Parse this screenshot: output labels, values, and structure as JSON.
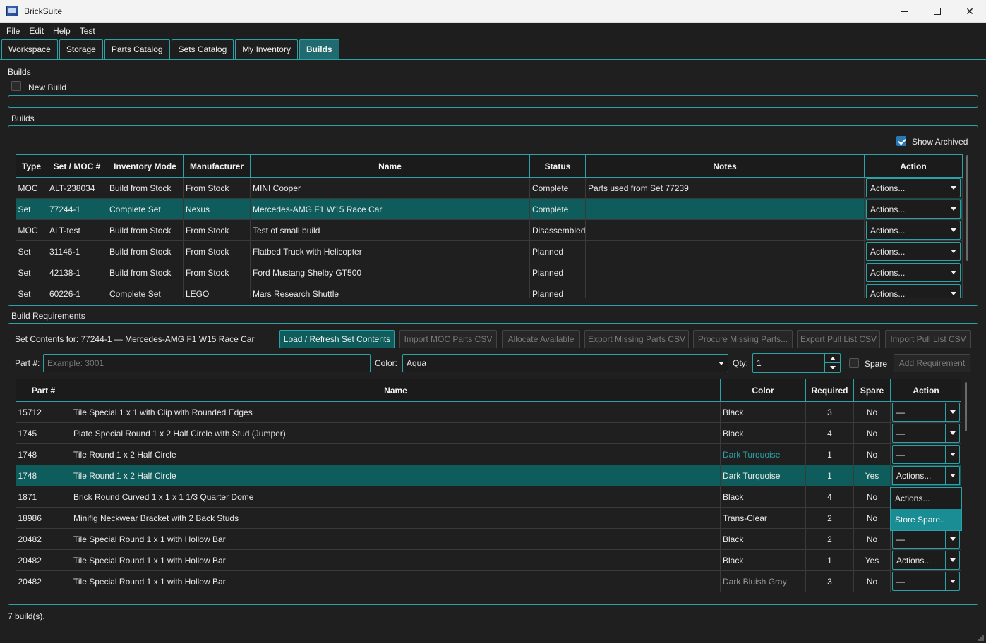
{
  "window": {
    "title": "BrickSuite",
    "min_icon": "minimize-icon",
    "max_icon": "maximize-icon",
    "close_icon": "close-icon",
    "close_glyph": "✕"
  },
  "menu": [
    "File",
    "Edit",
    "Help",
    "Test"
  ],
  "tabs": [
    {
      "label": "Workspace",
      "active": false
    },
    {
      "label": "Storage",
      "active": false
    },
    {
      "label": "Parts Catalog",
      "active": false
    },
    {
      "label": "Sets Catalog",
      "active": false
    },
    {
      "label": "My Inventory",
      "active": false
    },
    {
      "label": "Builds",
      "active": true
    }
  ],
  "builds_header": {
    "title": "Builds",
    "new_build_label": "New Build"
  },
  "builds_group": {
    "title": "Builds",
    "show_archived_label": "Show Archived",
    "show_archived": true,
    "columns": [
      "Type",
      "Set / MOC #",
      "Inventory Mode",
      "Manufacturer",
      "Name",
      "Status",
      "Notes",
      "Action"
    ],
    "rows": [
      {
        "type": "MOC",
        "number": "ALT-238034",
        "mode": "Build from Stock",
        "manufacturer": "From Stock",
        "name": "MINI Cooper",
        "status": "Complete",
        "notes": "Parts used from Set 77239",
        "action": "Actions..."
      },
      {
        "type": "Set",
        "number": "77244-1",
        "mode": "Complete Set",
        "manufacturer": "Nexus",
        "name": "Mercedes-AMG F1 W15 Race Car",
        "status": "Complete",
        "notes": "",
        "action": "Actions...",
        "selected": true
      },
      {
        "type": "MOC",
        "number": "ALT-test",
        "mode": "Build from Stock",
        "manufacturer": "From Stock",
        "name": "Test of small build",
        "status": "Disassembled",
        "notes": "",
        "action": "Actions..."
      },
      {
        "type": "Set",
        "number": "31146-1",
        "mode": "Build from Stock",
        "manufacturer": "From Stock",
        "name": "Flatbed Truck with Helicopter",
        "status": "Planned",
        "notes": "",
        "action": "Actions..."
      },
      {
        "type": "Set",
        "number": "42138-1",
        "mode": "Build from Stock",
        "manufacturer": "From Stock",
        "name": "Ford Mustang Shelby GT500",
        "status": "Planned",
        "notes": "",
        "action": "Actions..."
      },
      {
        "type": "Set",
        "number": "60226-1",
        "mode": "Complete Set",
        "manufacturer": "LEGO",
        "name": "Mars Research Shuttle",
        "status": "Planned",
        "notes": "",
        "action": "Actions..."
      }
    ]
  },
  "requirements": {
    "title": "Build Requirements",
    "set_contents_label": "Set Contents for: 77244-1 — Mercedes-AMG F1 W15 Race Car",
    "buttons": {
      "load_refresh": "Load / Refresh Set Contents",
      "import_moc": "Import MOC Parts CSV",
      "allocate": "Allocate Available",
      "export_missing": "Export Missing Parts CSV",
      "procure_missing": "Procure Missing Parts...",
      "export_pull": "Export Pull List CSV",
      "import_pull": "Import Pull List CSV",
      "add_requirement": "Add Requirement"
    },
    "part_label": "Part #:",
    "part_placeholder": "Example: 3001",
    "color_label": "Color:",
    "color_value": "Aqua",
    "qty_label": "Qty:",
    "qty_value": "1",
    "spare_label": "Spare",
    "spare_checked": false,
    "columns": [
      "Part #",
      "Name",
      "Color",
      "Required",
      "Spare",
      "Action"
    ],
    "rows": [
      {
        "part": "15712",
        "name": "Tile Special 1 x 1 with Clip with Rounded Edges",
        "color": "Black",
        "color_style": "normal",
        "required": "3",
        "spare": "No",
        "action": "—"
      },
      {
        "part": "1745",
        "name": "Plate Special Round 1 x 2 Half Circle with Stud (Jumper)",
        "color": "Black",
        "color_style": "normal",
        "required": "4",
        "spare": "No",
        "action": "—"
      },
      {
        "part": "1748",
        "name": "Tile Round 1 x 2 Half Circle",
        "color": "Dark Turquoise",
        "color_style": "teal",
        "required": "1",
        "spare": "No",
        "action": "—"
      },
      {
        "part": "1748",
        "name": "Tile Round 1 x 2 Half Circle",
        "color": "Dark Turquoise",
        "color_style": "normal",
        "required": "1",
        "spare": "Yes",
        "action": "Actions...",
        "selected": true,
        "open": true
      },
      {
        "part": "1871",
        "name": "Brick Round Curved 1 x 1 x 1 1/3 Quarter Dome",
        "color": "Black",
        "color_style": "normal",
        "required": "4",
        "spare": "No",
        "action": ""
      },
      {
        "part": "18986",
        "name": "Minifig Neckwear Bracket with 2 Back Studs",
        "color": "Trans-Clear",
        "color_style": "normal",
        "required": "2",
        "spare": "No",
        "action": ""
      },
      {
        "part": "20482",
        "name": "Tile Special Round 1 x 1 with Hollow Bar",
        "color": "Black",
        "color_style": "normal",
        "required": "2",
        "spare": "No",
        "action": "—"
      },
      {
        "part": "20482",
        "name": "Tile Special Round 1 x 1 with Hollow Bar",
        "color": "Black",
        "color_style": "normal",
        "required": "1",
        "spare": "Yes",
        "action": "Actions..."
      },
      {
        "part": "20482",
        "name": "Tile Special Round 1 x 1 with Hollow Bar",
        "color": "Dark Bluish Gray",
        "color_style": "gray",
        "required": "3",
        "spare": "No",
        "action": "—"
      }
    ],
    "dropdown_items": [
      "Actions...",
      "Store Spare..."
    ]
  },
  "status_bar": "7 build(s).",
  "colors": {
    "accent": "#2aa3a8",
    "selected_row": "#0f5c5c",
    "active_tab": "#1f6b70",
    "dropdown_highlight": "#1a8d94"
  }
}
